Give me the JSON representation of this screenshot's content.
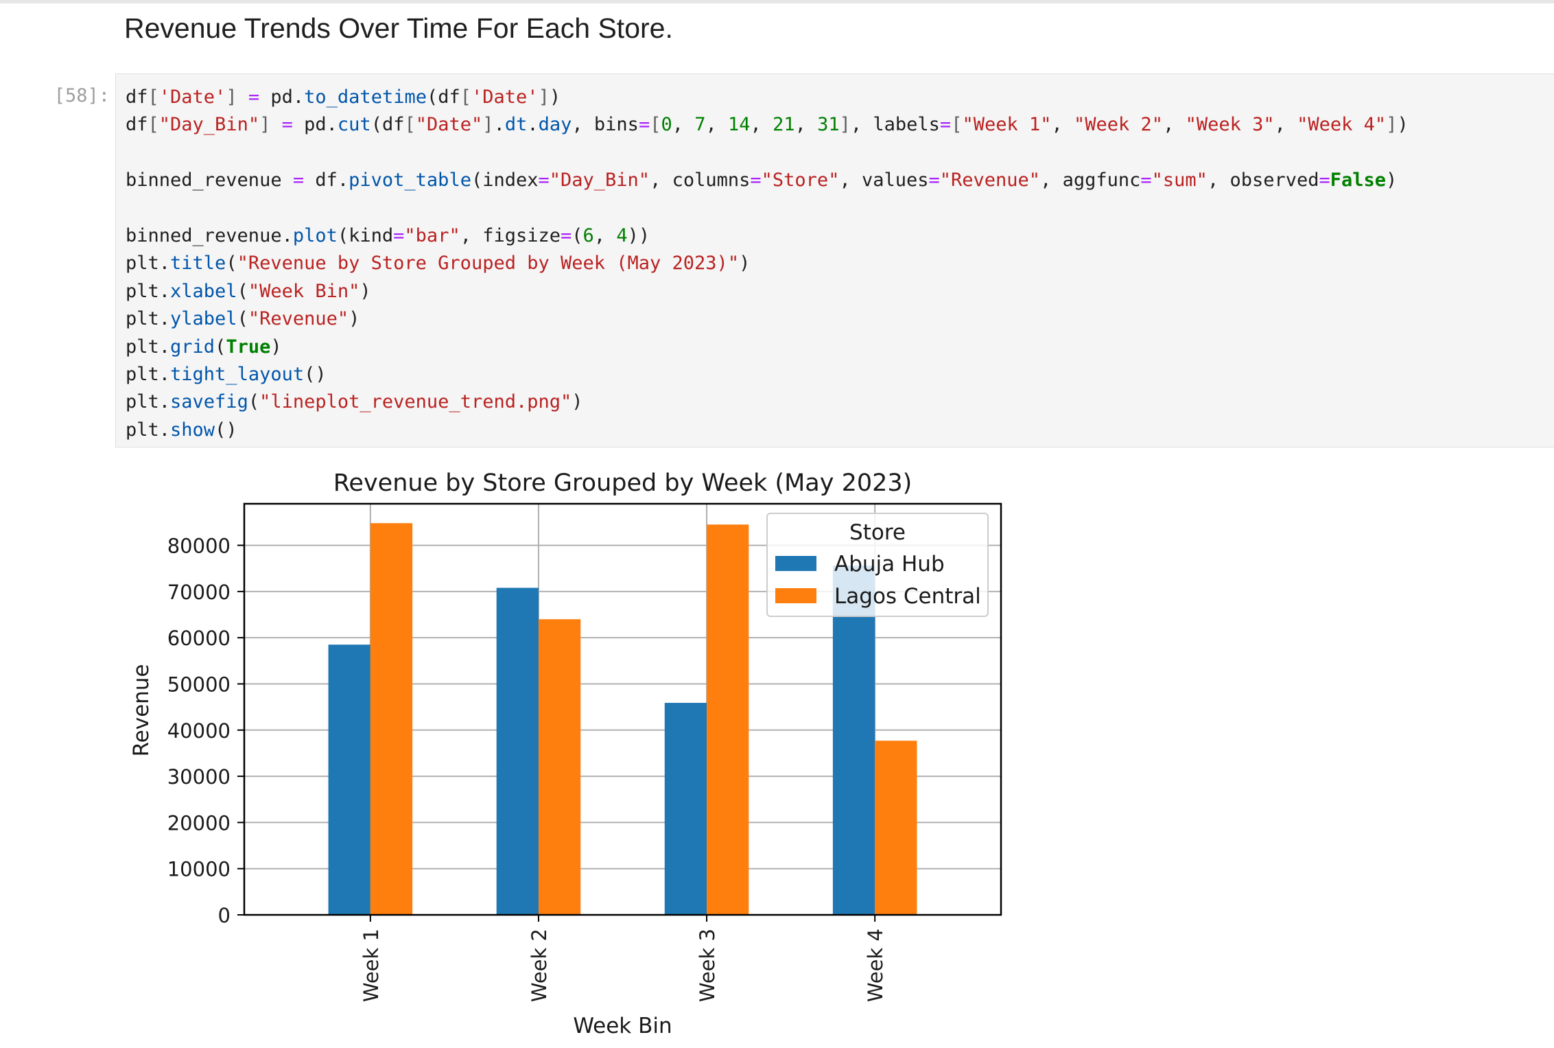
{
  "notebook": {
    "markdown_heading": "Revenue Trends Over Time For Each Store.",
    "cell_prompt": "[58]:",
    "code_lines": [
      [
        [
          "df",
          "p"
        ],
        [
          "[",
          "b"
        ],
        [
          "'Date'",
          "s"
        ],
        [
          "]",
          "b"
        ],
        [
          " ",
          "p"
        ],
        [
          "=",
          "o"
        ],
        [
          " pd.",
          "p"
        ],
        [
          "to_datetime",
          "f"
        ],
        [
          "(df",
          "p"
        ],
        [
          "[",
          "b"
        ],
        [
          "'Date'",
          "s"
        ],
        [
          "]",
          "b"
        ],
        [
          ")",
          "p"
        ]
      ],
      [
        [
          "df",
          "p"
        ],
        [
          "[",
          "b"
        ],
        [
          "\"Day_Bin\"",
          "s"
        ],
        [
          "]",
          "b"
        ],
        [
          " ",
          "p"
        ],
        [
          "=",
          "o"
        ],
        [
          " pd.",
          "p"
        ],
        [
          "cut",
          "f"
        ],
        [
          "(df",
          "p"
        ],
        [
          "[",
          "b"
        ],
        [
          "\"Date\"",
          "s"
        ],
        [
          "]",
          "b"
        ],
        [
          ".",
          "p"
        ],
        [
          "dt",
          "f"
        ],
        [
          ".",
          "p"
        ],
        [
          "day",
          "f"
        ],
        [
          ", bins",
          "p"
        ],
        [
          "=",
          "o"
        ],
        [
          "[",
          "b"
        ],
        [
          "0",
          "n"
        ],
        [
          ", ",
          "p"
        ],
        [
          "7",
          "n"
        ],
        [
          ", ",
          "p"
        ],
        [
          "14",
          "n"
        ],
        [
          ", ",
          "p"
        ],
        [
          "21",
          "n"
        ],
        [
          ", ",
          "p"
        ],
        [
          "31",
          "n"
        ],
        [
          "]",
          "b"
        ],
        [
          ", labels",
          "p"
        ],
        [
          "=",
          "o"
        ],
        [
          "[",
          "b"
        ],
        [
          "\"Week 1\"",
          "s"
        ],
        [
          ", ",
          "p"
        ],
        [
          "\"Week 2\"",
          "s"
        ],
        [
          ", ",
          "p"
        ],
        [
          "\"Week 3\"",
          "s"
        ],
        [
          ", ",
          "p"
        ],
        [
          "\"Week 4\"",
          "s"
        ],
        [
          "]",
          "b"
        ],
        [
          ")",
          "p"
        ]
      ],
      [],
      [
        [
          "binned_revenue ",
          "p"
        ],
        [
          "=",
          "o"
        ],
        [
          " df.",
          "p"
        ],
        [
          "pivot_table",
          "f"
        ],
        [
          "(index",
          "p"
        ],
        [
          "=",
          "o"
        ],
        [
          "\"Day_Bin\"",
          "s"
        ],
        [
          ", columns",
          "p"
        ],
        [
          "=",
          "o"
        ],
        [
          "\"Store\"",
          "s"
        ],
        [
          ", values",
          "p"
        ],
        [
          "=",
          "o"
        ],
        [
          "\"Revenue\"",
          "s"
        ],
        [
          ", aggfunc",
          "p"
        ],
        [
          "=",
          "o"
        ],
        [
          "\"sum\"",
          "s"
        ],
        [
          ", observed",
          "p"
        ],
        [
          "=",
          "o"
        ],
        [
          "False",
          "k"
        ],
        [
          ")",
          "p"
        ]
      ],
      [],
      [
        [
          "binned_revenue.",
          "p"
        ],
        [
          "plot",
          "f"
        ],
        [
          "(kind",
          "p"
        ],
        [
          "=",
          "o"
        ],
        [
          "\"bar\"",
          "s"
        ],
        [
          ", figsize",
          "p"
        ],
        [
          "=",
          "o"
        ],
        [
          "(",
          "p"
        ],
        [
          "6",
          "n"
        ],
        [
          ", ",
          "p"
        ],
        [
          "4",
          "n"
        ],
        [
          "))",
          "p"
        ]
      ],
      [
        [
          "plt.",
          "p"
        ],
        [
          "title",
          "f"
        ],
        [
          "(",
          "p"
        ],
        [
          "\"Revenue by Store Grouped by Week (May 2023)\"",
          "s"
        ],
        [
          ")",
          "p"
        ]
      ],
      [
        [
          "plt.",
          "p"
        ],
        [
          "xlabel",
          "f"
        ],
        [
          "(",
          "p"
        ],
        [
          "\"Week Bin\"",
          "s"
        ],
        [
          ")",
          "p"
        ]
      ],
      [
        [
          "plt.",
          "p"
        ],
        [
          "ylabel",
          "f"
        ],
        [
          "(",
          "p"
        ],
        [
          "\"Revenue\"",
          "s"
        ],
        [
          ")",
          "p"
        ]
      ],
      [
        [
          "plt.",
          "p"
        ],
        [
          "grid",
          "f"
        ],
        [
          "(",
          "p"
        ],
        [
          "True",
          "k"
        ],
        [
          ")",
          "p"
        ]
      ],
      [
        [
          "plt.",
          "p"
        ],
        [
          "tight_layout",
          "f"
        ],
        [
          "()",
          "p"
        ]
      ],
      [
        [
          "plt.",
          "p"
        ],
        [
          "savefig",
          "f"
        ],
        [
          "(",
          "p"
        ],
        [
          "\"lineplot_revenue_trend.png\"",
          "s"
        ],
        [
          ")",
          "p"
        ]
      ],
      [
        [
          "plt.",
          "p"
        ],
        [
          "show",
          "f"
        ],
        [
          "()",
          "p"
        ]
      ]
    ]
  },
  "colors": {
    "abuja": "#1f77b4",
    "lagos": "#ff7f0e"
  },
  "chart_data": {
    "type": "bar",
    "title": "Revenue by Store Grouped by Week (May 2023)",
    "xlabel": "Week Bin",
    "ylabel": "Revenue",
    "categories": [
      "Week 1",
      "Week 2",
      "Week 3",
      "Week 4"
    ],
    "series": [
      {
        "name": "Abuja Hub",
        "values": [
          58500,
          70800,
          45900,
          75600
        ]
      },
      {
        "name": "Lagos Central",
        "values": [
          84800,
          64000,
          84500,
          37700
        ]
      }
    ],
    "yticks": [
      0,
      10000,
      20000,
      30000,
      40000,
      50000,
      60000,
      70000,
      80000
    ],
    "ylim": [
      0,
      89000
    ],
    "grid": true,
    "legend": {
      "title": "Store",
      "placement": "top-right"
    }
  }
}
